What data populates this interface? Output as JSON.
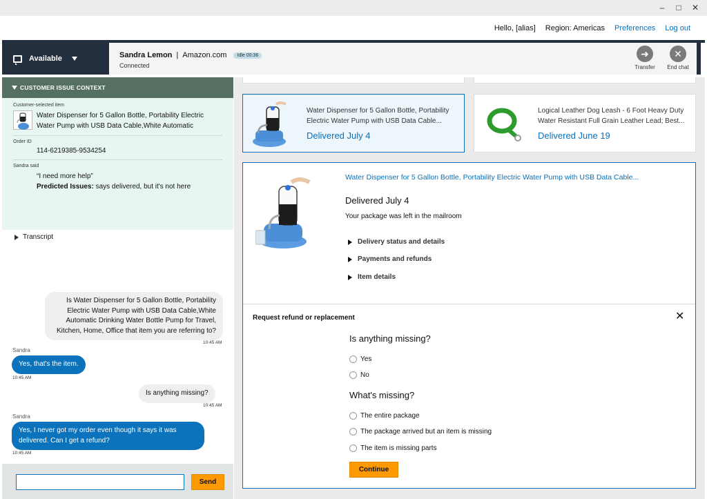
{
  "window": {
    "minimize": "–",
    "maximize": "□",
    "close": "✕"
  },
  "userbar": {
    "greeting": "Hello, [alias]",
    "region": "Region: Americas",
    "preferences": "Preferences",
    "logout": "Log out"
  },
  "status": {
    "label": "Available"
  },
  "contact": {
    "name": "Sandra Lemon",
    "separator": "|",
    "source": "Amazon.com",
    "idle": "Idle 00:36",
    "state": "Connected",
    "transfer": "Transfer",
    "end_chat": "End chat"
  },
  "context": {
    "header": "CUSTOMER ISSUE CONTEXT",
    "item_label": "Customer-selected item",
    "item_title": "Water Dispenser for 5 Gallon Bottle, Portability Electric Water Pump with USB Data Cable,White Automatic",
    "order_label": "Order ID",
    "order_id": "114-6219385-9534254",
    "said_label": "Sandra said",
    "quote": "“I need more help”",
    "predicted_label": "Predicted Issues:",
    "predicted_value": " says delivered, but it's not here",
    "transcript": "Transcript"
  },
  "chat": {
    "m1_text": "Is Water Dispenser for 5 Gallon Bottle, Portability Electric Water Pump with USB Data Cable,White Automatic Drinking Water Bottle Pump for Travel, Kitchen, Home, Office that item you are referring to?",
    "m1_time": "10:45 AM",
    "m2_sender": "Sandra",
    "m2_text": "Yes, that's the item.",
    "m2_time": "10:45 AM",
    "m3_text": "Is anything missing?",
    "m3_time": "10:45 AM",
    "m4_sender": "Sandra",
    "m4_text": "Yes, I never got my order even though it says it was delivered. Can I get a refund?",
    "m4_time": "10:45 AM"
  },
  "compose": {
    "value": "",
    "send": "Send"
  },
  "orders": [
    {
      "title": "Water Dispenser for 5 Gallon Bottle, Portability Electric Water Pump with USB Data Cable...",
      "status": "Delivered July 4"
    },
    {
      "title": "Logical Leather Dog Leash - 6 Foot Heavy Duty Water Resistant Full Grain Leather Lead; Best...",
      "status": "Delivered June 19"
    }
  ],
  "detail": {
    "link": "Water Dispenser for 5 Gallon Bottle, Portability Electric Water Pump with USB Data Cable...",
    "status": "Delivered July 4",
    "message": "Your package was left in the mailroom",
    "expanders": [
      "Delivery status and details",
      "Payments and refunds",
      "Item details"
    ],
    "request_title": "Request refund or replacement",
    "close": "✕",
    "q1": "Is anything missing?",
    "q1_options": [
      "Yes",
      "No"
    ],
    "q2": "What's missing?",
    "q2_options": [
      "The entire package",
      "The package arrived but an item is missing",
      "The item is missing parts"
    ],
    "continue": "Continue"
  },
  "colors": {
    "navy": "#232f3e",
    "accent_blue": "#0a6fb8",
    "orange": "#ff9900",
    "context_green": "#557062"
  }
}
